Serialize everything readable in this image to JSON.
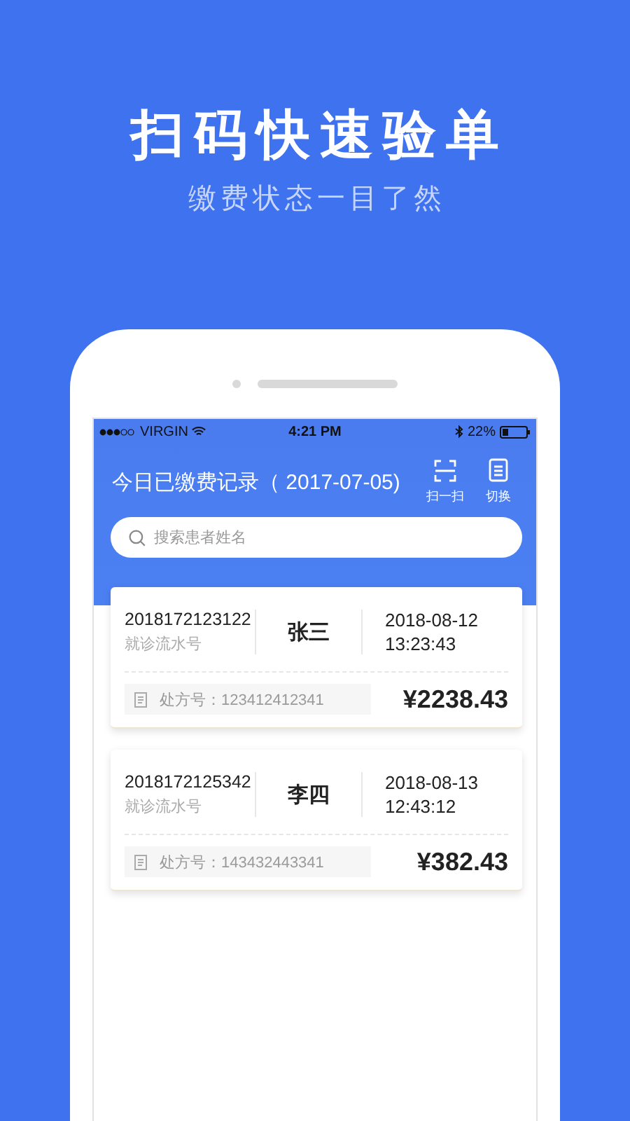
{
  "promo": {
    "title": "扫码快速验单",
    "subtitle": "缴费状态一目了然"
  },
  "status_bar": {
    "carrier": "VIRGIN",
    "time": "4:21 PM",
    "battery": "22%"
  },
  "app_bar": {
    "title": "今日已缴费记录（ 2017-07-05)",
    "actions": [
      {
        "kind": "scan",
        "label": "扫一扫"
      },
      {
        "kind": "list",
        "label": "切换"
      }
    ]
  },
  "search": {
    "placeholder": "搜索患者姓名"
  },
  "records": [
    {
      "serial": "2018172123122",
      "serial_label": "就诊流水号",
      "name": "张三",
      "date": "2018-08-12",
      "time": "13:23:43",
      "prescription": "处方号：123412412341",
      "amount": "¥2238.43"
    },
    {
      "serial": "2018172125342",
      "serial_label": "就诊流水号",
      "name": "李四",
      "date": "2018-08-13",
      "time": "12:43:12",
      "prescription": "处方号：143432443341",
      "amount": "¥382.43"
    }
  ]
}
